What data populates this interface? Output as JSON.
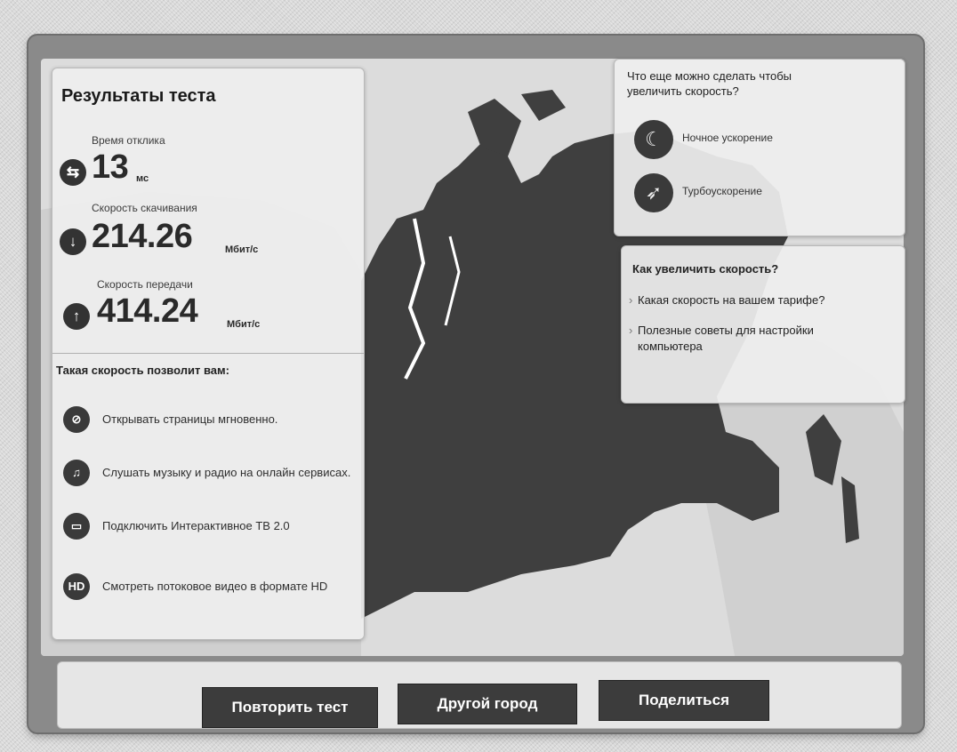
{
  "results": {
    "title": "Результаты теста",
    "ping": {
      "label": "Время отклика",
      "value": "13",
      "unit": "мс"
    },
    "download": {
      "label": "Скорость скачивания",
      "value": "214.26",
      "unit": "Мбит/с"
    },
    "upload": {
      "label": "Скорость передачи",
      "value": "414.24",
      "unit": "Мбит/с"
    },
    "allows_title": "Такая скорость позволит вам:",
    "features": [
      {
        "icon": "browser-icon",
        "text": "Открывать страницы мгновенно."
      },
      {
        "icon": "music-icon",
        "text": "Слушать музыку и радио на онлайн сервисах."
      },
      {
        "icon": "tv-icon",
        "text": "Подключить Интерактивное ТВ 2.0"
      },
      {
        "icon": "hd-icon",
        "badge": "HD",
        "text": "Смотреть потоковое видео в формате HD"
      }
    ]
  },
  "more": {
    "title": "Что еще можно сделать чтобы увеличить скорость?",
    "items": [
      {
        "icon": "moon-icon",
        "label": "Ночное ускорение"
      },
      {
        "icon": "rocket-icon",
        "label": "Турбоускорение"
      }
    ]
  },
  "how": {
    "title": "Как увеличить скорость?",
    "links": [
      {
        "label": "Какая скорость на вашем тарифе?"
      },
      {
        "label": "Полезные советы для настройки компьютера"
      }
    ]
  },
  "buttons": {
    "repeat": "Повторить тест",
    "city": "Другой город",
    "share": "Поделиться"
  },
  "colors": {
    "map_land": "#3f3f3f",
    "map_sea": "#dcdcdc",
    "button_bg": "#3c3c3c"
  }
}
